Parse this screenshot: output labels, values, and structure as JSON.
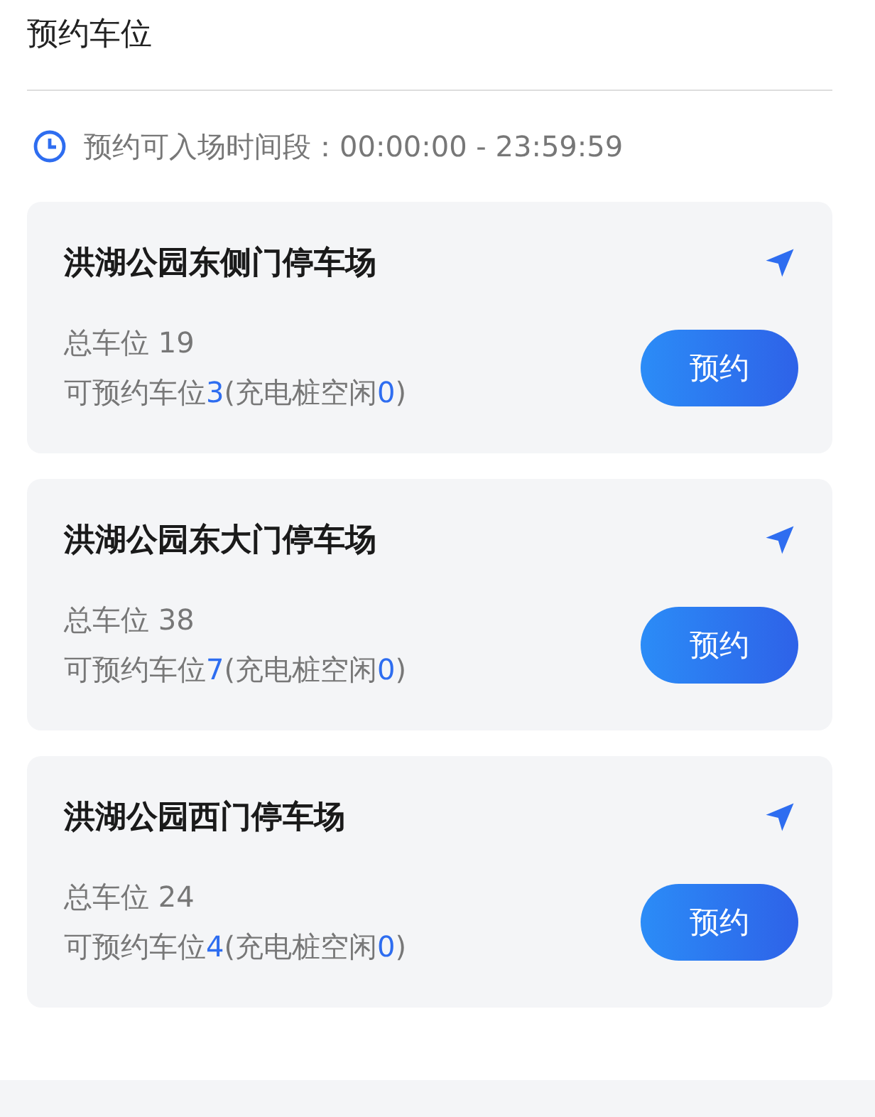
{
  "page_title": "预约车位",
  "entry_window": {
    "text": "预约可入场时间段：00:00:00 - 23:59:59"
  },
  "lots": [
    {
      "name": "洪湖公园东侧门停车场",
      "total": "总车位 19",
      "available_label": "可预约车位",
      "available_count": "3",
      "charging_label": "(充电桩空闲",
      "charging_count": "0",
      "charging_close": ")",
      "button": "预约"
    },
    {
      "name": "洪湖公园东大门停车场",
      "total": "总车位 38",
      "available_label": "可预约车位",
      "available_count": "7",
      "charging_label": "(充电桩空闲",
      "charging_count": "0",
      "charging_close": ")",
      "button": "预约"
    },
    {
      "name": "洪湖公园西门停车场",
      "total": "总车位 24",
      "available_label": "可预约车位",
      "available_count": "4",
      "charging_label": "(充电桩空闲",
      "charging_count": "0",
      "charging_close": ")",
      "button": "预约"
    }
  ]
}
